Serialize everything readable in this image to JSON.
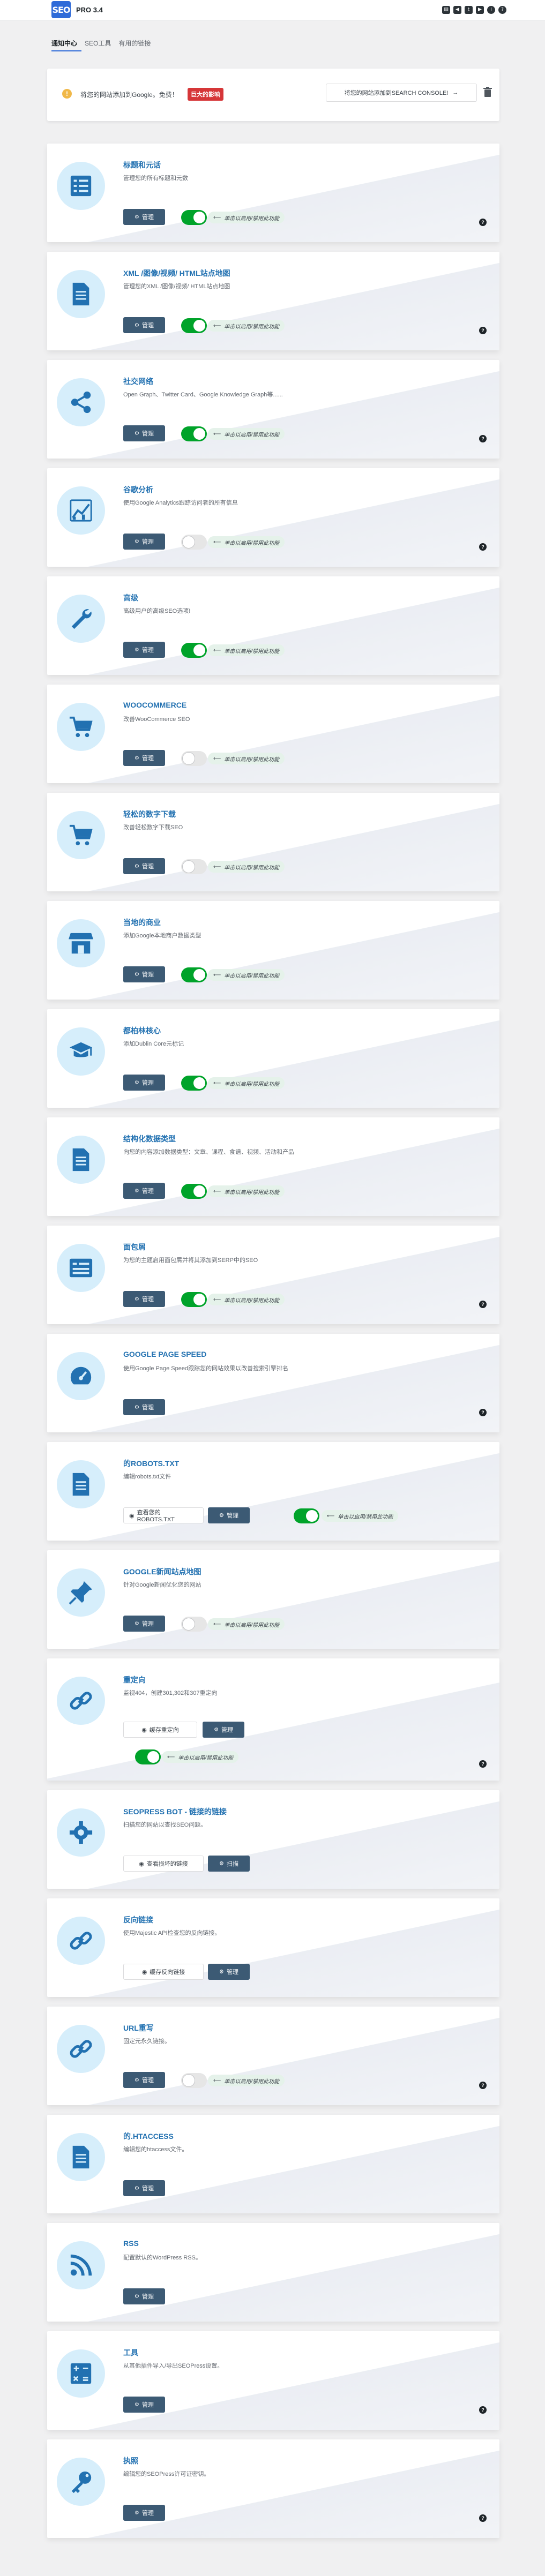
{
  "header": {
    "logo": "SEO",
    "version": "PRO 3.4",
    "icons": [
      "document-icon",
      "megaphone-icon",
      "twitter-icon",
      "youtube-icon",
      "info-icon",
      "help-icon"
    ]
  },
  "tabs": [
    "通知中心",
    "SEO工具",
    "有用的链接"
  ],
  "notice": {
    "text": "将您的网站添加到Google。免费！",
    "badge": "巨大的影响",
    "button": "将您的网站添加到SEARCH CONSOLE!",
    "button_arrow": "→"
  },
  "common": {
    "manage": "管理",
    "hint": "单击以启用/禁用此功能",
    "help": "?"
  },
  "cards": [
    {
      "title": "标题和元话",
      "desc": "管理您的所有标题和元数",
      "icon": "list-icon"
    },
    {
      "title": "XML /图像/视频/ HTML站点地图",
      "desc": "管理您的XML /图像/视频/ HTML站点地图",
      "icon": "sitemap-icon"
    },
    {
      "title": "社交网络",
      "desc": "Open Graph、Twitter Card、Google Knowledge Graph等......",
      "icon": "share-icon"
    },
    {
      "title": "谷歌分析",
      "desc": "使用Google Analytics跟踪访问者的所有信息",
      "icon": "analytics-icon"
    },
    {
      "title": "高级",
      "desc": "高级用户的高级SEO选项!",
      "icon": "wrench-icon"
    },
    {
      "title": "WOOCOMMERCE",
      "desc": "改善WooCommerce SEO",
      "icon": "cart-icon"
    },
    {
      "title": "轻松的数字下载",
      "desc": "改善轻松数字下载SEO",
      "icon": "cart-icon"
    },
    {
      "title": "当地的商业",
      "desc": "添加Google本地商户数据类型",
      "icon": "store-icon"
    },
    {
      "title": "都柏林核心",
      "desc": "添加Dublin Core元标记",
      "icon": "graduation-icon"
    },
    {
      "title": "结构化数据类型",
      "desc": "向您的内容添加数据类型：文章、课程、食谱、视频、活动和产品",
      "icon": "document-icon"
    },
    {
      "title": "面包屑",
      "desc": "为您的主题启用面包屑并将其添加到SERP中的SEO",
      "icon": "breadcrumb-icon"
    },
    {
      "title": "GOOGLE PAGE SPEED",
      "desc": "使用Google Page Speed跟踪您的网站效果以改善搜索引擎排名",
      "icon": "speed-icon"
    },
    {
      "title": "的ROBOTS.TXT",
      "desc": "编辑robots.txt文件",
      "icon": "document-icon",
      "secondary": "查看您的ROBOTS.TXT"
    },
    {
      "title": "GOOGLE新闻站点地图",
      "desc": "针对Google新闻优化您的网站",
      "icon": "pin-icon"
    },
    {
      "title": "重定向",
      "desc": "监视404，创建301,302和307重定向",
      "icon": "link-icon",
      "secondary": "缓存重定向"
    },
    {
      "title": "SEOPRESS BOT - 链接的链接",
      "desc": "扫描您的网站以查找SEO问题。",
      "icon": "gear-icon",
      "secondary": "查看损坏的链接",
      "primary": "扫描"
    },
    {
      "title": "反向链接",
      "desc": "使用Majestic API检查您的反向链接。",
      "icon": "link-icon",
      "secondary": "缓存反向链接"
    },
    {
      "title": "URL重写",
      "desc": "固定元永久链接。",
      "icon": "link-icon"
    },
    {
      "title": "的.HTACCESS",
      "desc": "编辑您的htaccess文件。",
      "icon": "document-icon"
    },
    {
      "title": "RSS",
      "desc": "配置默认的WordPress RSS。",
      "icon": "rss-icon"
    },
    {
      "title": "工具",
      "desc": "从其他插件导入/导出SEOPress设置。",
      "icon": "calculator-icon"
    },
    {
      "title": "执照",
      "desc": "编辑您的SEOPress许可证密钥。",
      "icon": "key-icon"
    }
  ]
}
